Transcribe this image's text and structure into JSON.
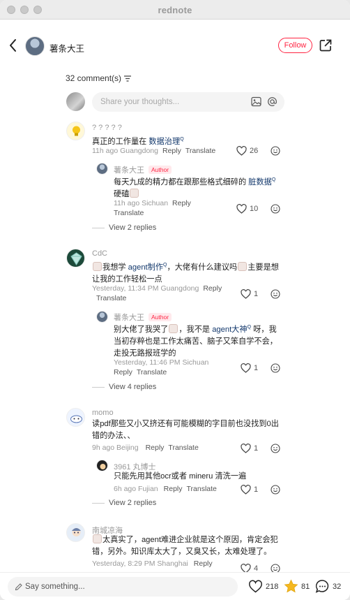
{
  "window": {
    "title": "rednote"
  },
  "header": {
    "author_name": "薯条大王",
    "follow_label": "Follow"
  },
  "comments_header": {
    "count_label": "32 comment(s)"
  },
  "share_input": {
    "placeholder": "Share your thoughts..."
  },
  "comments": [
    {
      "name": "? ? ? ? ?",
      "text_before": "真正的工作量在 ",
      "link": "数据治理",
      "text_after": "",
      "meta": "11h ago Guangdong",
      "reply_label": "Reply",
      "translate_label": "Translate",
      "likes": "26",
      "replies": [
        {
          "name": "薯条大王",
          "badge": "Author",
          "text_before": "每天九成的精力都在跟那些格式细碎的 ",
          "link": "脏数据",
          "text_after": " 硬磕",
          "meta": "11h ago Sichuan",
          "reply_label": "Reply",
          "translate_label": "Translate",
          "likes": "10"
        }
      ],
      "view_replies": "View 2 replies"
    },
    {
      "name": "CdC",
      "text_before": "我想学 ",
      "link": "agent制作",
      "text_after": "，大佬有什么建议吗",
      "text_line2": "主要是想让我的工作轻松一点",
      "meta": "Yesterday, 11:34 PM Guangdong",
      "reply_label": "Reply",
      "translate_label": "Translate",
      "likes": "1",
      "replies": [
        {
          "name": "薯条大王",
          "badge": "Author",
          "text_before": "别大佬了我哭了",
          "mid": "，我不是 ",
          "link": "agent大神",
          "text_after": " 呀，我当初存粹也是工作太痛苦、脑子又笨自学不会，走投无路报班学的",
          "meta": "Yesterday, 11:46 PM Sichuan",
          "reply_label": "Reply",
          "translate_label": "Translate",
          "likes": "1"
        }
      ],
      "view_replies": "View 4 replies"
    },
    {
      "name": "momo",
      "text": "读pdf那些又小又挤还有可能模糊的字目前也没找到0出错的办法、、",
      "meta": "9h ago Beijing",
      "reply_label": "Reply",
      "translate_label": "Translate",
      "likes": "1",
      "replies": [
        {
          "name": "3961 丸博士",
          "text": "只能先用其他ocr或者 mineru 清洗一遍",
          "meta": "6h ago Fujian",
          "reply_label": "Reply",
          "translate_label": "Translate",
          "likes": "1"
        }
      ],
      "view_replies": "View 2 replies"
    },
    {
      "name": "南城凉海",
      "text": "太真实了，agent难进企业就是这个原因，肯定会犯错，另外。知识库太大了，又臭又长，太难处理了。",
      "meta": "Yesterday, 8:29 PM Shanghai",
      "reply_label": "Reply",
      "likes": "4"
    }
  ],
  "bottom_bar": {
    "placeholder": "Say something...",
    "likes": "218",
    "collects": "81",
    "comments": "32"
  },
  "colors": {
    "accent": "#ff2442",
    "link": "#13386c",
    "star": "#f5b820"
  }
}
